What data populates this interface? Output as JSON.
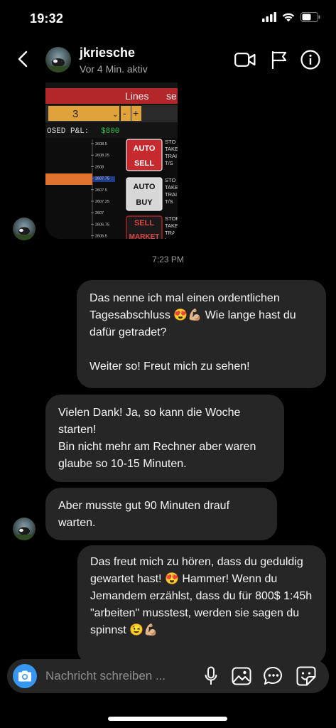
{
  "status_bar": {
    "time": "19:32"
  },
  "header": {
    "username": "jkriesche",
    "activity": "Vor 4 Min. aktiv",
    "icons": [
      "back-chevron-icon",
      "video-call-icon",
      "flag-icon",
      "info-icon"
    ]
  },
  "shared_photo": {
    "tab_label": "Lines",
    "tab_label_2": "se",
    "quantity": "3",
    "pnl_label": "OSED P&L:",
    "pnl_value": "$800",
    "ladder_prices": [
      "2608.5",
      "2608.25",
      "2608",
      "2607.75",
      "2607.5",
      "2607.25",
      "2607",
      "2606.75",
      "2606.5"
    ],
    "button_auto_sell": "AUTO\nSELL",
    "button_auto_buy": "AUTO\nBUY",
    "button_sell_market": "SELL\nMARKET",
    "side_labels_1": "STO\nTAKE\nTRAI\nT/S",
    "side_labels_2": "STO\nTAKE\nTRAI\nT/S",
    "side_labels_3": "STOP\nTAKE\nTRAI\nT/S"
  },
  "timestamp": "7:23 PM",
  "messages": [
    {
      "text": "Das nenne ich mal einen ordentlichen Tagesabschluss 😍💪🏼 Wie lange hast du dafür getradet?\n\nWeiter so! Freut mich zu sehen!"
    },
    {
      "text": "Vielen Dank! Ja, so kann die Woche starten!\nBin nicht mehr am Rechner aber waren glaube so 10-15 Minuten."
    },
    {
      "text": "Aber musste gut 90 Minuten drauf warten."
    },
    {
      "text": "Das freut mich zu hören, dass du geduldig gewartet hast! 😍 Hammer! Wenn du Jemandem erzählst, dass du für 800$ 1:45h \"arbeiten\" musstest, werden sie sagen du spinnst 😉💪🏼"
    }
  ],
  "composer": {
    "placeholder": "Nachricht schreiben ...",
    "icons": [
      "camera-icon",
      "microphone-icon",
      "gallery-icon",
      "chat-bubble-icon",
      "sticker-icon"
    ]
  },
  "colors": {
    "accent": "#3797f0",
    "bubble": "#262626",
    "background": "#000000"
  }
}
